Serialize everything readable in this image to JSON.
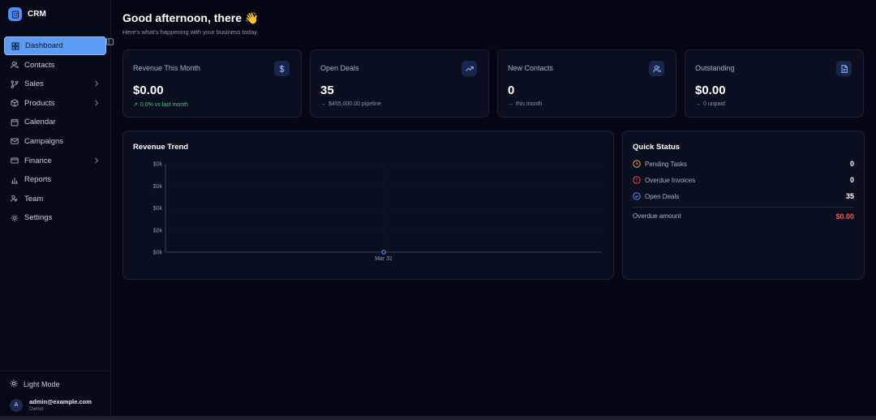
{
  "brand": {
    "name": "CRM",
    "icon": "building-icon"
  },
  "nav": [
    {
      "label": "Dashboard",
      "icon": "grid-icon",
      "active": true,
      "chevron": false
    },
    {
      "label": "Contacts",
      "icon": "users-icon",
      "chevron": false
    },
    {
      "label": "Sales",
      "icon": "git-branch-icon",
      "chevron": true
    },
    {
      "label": "Products",
      "icon": "box-icon",
      "chevron": true
    },
    {
      "label": "Calendar",
      "icon": "calendar-icon",
      "chevron": false
    },
    {
      "label": "Campaigns",
      "icon": "mail-icon",
      "chevron": false
    },
    {
      "label": "Finance",
      "icon": "credit-card-icon",
      "chevron": true
    },
    {
      "label": "Reports",
      "icon": "bar-chart-icon",
      "chevron": false
    },
    {
      "label": "Team",
      "icon": "team-icon",
      "chevron": false
    },
    {
      "label": "Settings",
      "icon": "gear-icon",
      "chevron": false
    }
  ],
  "footer": {
    "theme_toggle": "Light Mode",
    "user": {
      "initial": "A",
      "email": "admin@example.com",
      "role": "Owner"
    }
  },
  "header": {
    "greeting": "Good afternoon, there 👋",
    "subtitle": "Here's what's happening with your business today."
  },
  "cards": [
    {
      "title": "Revenue This Month",
      "value": "$0.00",
      "sub": "0.0% vs last month",
      "sub_prefix": "↗",
      "positive": true,
      "icon": "dollar-icon"
    },
    {
      "title": "Open Deals",
      "value": "35",
      "sub": "$455,000.00 pipeline",
      "sub_prefix": "→",
      "positive": false,
      "icon": "trending-up-icon"
    },
    {
      "title": "New Contacts",
      "value": "0",
      "sub": "this month",
      "sub_prefix": "→",
      "positive": false,
      "icon": "users-icon"
    },
    {
      "title": "Outstanding",
      "value": "$0.00",
      "sub": "0 unpaid",
      "sub_prefix": "→",
      "positive": false,
      "icon": "file-icon"
    }
  ],
  "trend": {
    "title": "Revenue Trend"
  },
  "chart_data": {
    "type": "line",
    "title": "Revenue Trend",
    "x": [
      "Mar 31"
    ],
    "series": [
      {
        "values": [
          0
        ]
      }
    ],
    "y_ticks": [
      "$0k",
      "$0k",
      "$0k",
      "$0k",
      "$0k"
    ],
    "grid": true,
    "colors": {
      "line": "#4f8ef7",
      "grid": "#1a2138",
      "axis": "#3a4259"
    }
  },
  "quick_status": {
    "title": "Quick Status",
    "rows": [
      {
        "label": "Pending Tasks",
        "value": "0",
        "icon": "clock-icon",
        "color": "#f0a032"
      },
      {
        "label": "Overdue Invoices",
        "value": "0",
        "icon": "alert-circle-icon",
        "color": "#e5484d"
      },
      {
        "label": "Open Deals",
        "value": "35",
        "icon": "check-circle-icon",
        "color": "#4f8ef7"
      }
    ],
    "overdue_label": "Overdue amount",
    "overdue_value": "$0.00",
    "overdue_color": "#f05a4f"
  }
}
